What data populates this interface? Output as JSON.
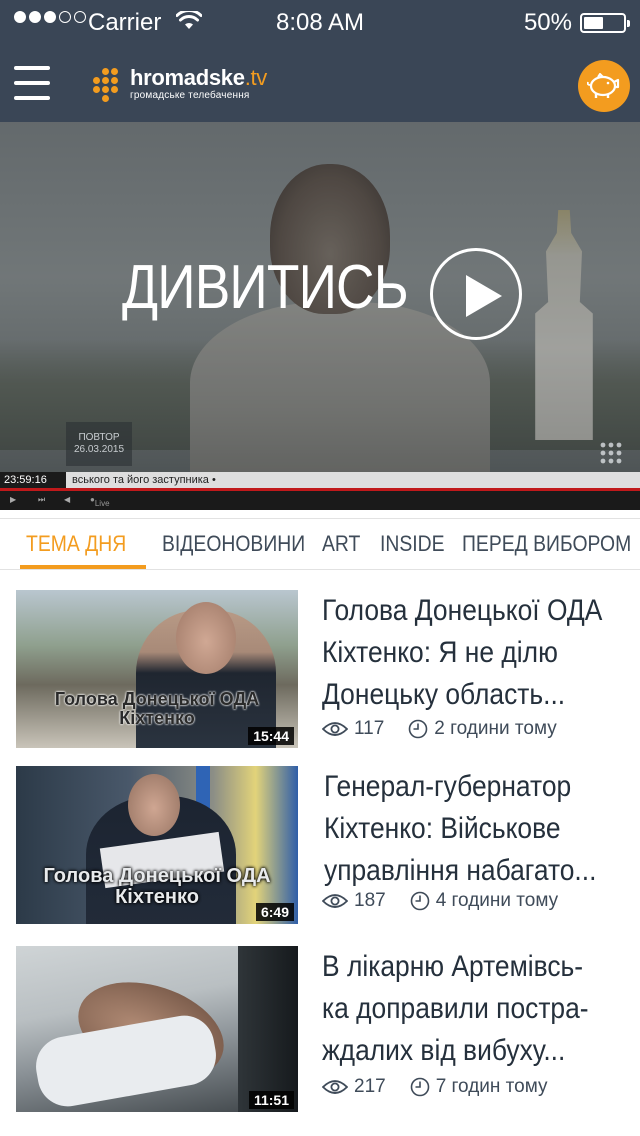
{
  "status_bar": {
    "carrier": "Carrier",
    "time": "8:08 AM",
    "battery": "50%"
  },
  "header": {
    "logo_name": "hromadske",
    "logo_tld": ".tv",
    "logo_subtitle": "громадське телебачення",
    "menu_icon": "hamburger-menu-icon",
    "donate_icon": "piggy-bank-icon"
  },
  "hero": {
    "watch_label": "ДИВИТИСЬ",
    "repeat_label": "ПОВТОР",
    "repeat_date": "26.03.2015",
    "ticker_time": "23:59:16",
    "ticker_text": "вського та його заступника •",
    "live_label": "Live"
  },
  "tabs": [
    {
      "label": "ТЕМА ДНЯ",
      "active": true
    },
    {
      "label": "ВІДЕОНОВИНИ",
      "active": false
    },
    {
      "label": "ART",
      "active": false
    },
    {
      "label": "INSIDE",
      "active": false
    },
    {
      "label": "ПЕРЕД ВИБОРОМ",
      "active": false
    }
  ],
  "news": [
    {
      "title_lines": [
        "Голова Донецької ОДА",
        "Кіхтенко: Я не ділю",
        "Донецьку область..."
      ],
      "caption_line1": "Голова Донецької ОДА",
      "caption_line2": "Кіхтенко",
      "duration": "15:44",
      "views": "117",
      "time_ago": "2 години тому"
    },
    {
      "title_lines": [
        "Генерал-губернатор",
        "Кіхтенко: Військове",
        "управління набагато..."
      ],
      "caption_line1": "Голова Донецької ОДА",
      "caption_line2": "Кіхтенко",
      "duration": "6:49",
      "views": "187",
      "time_ago": "4 години тому"
    },
    {
      "title_lines": [
        "В лікарню Артемівсь-",
        "ка доправили постра-",
        "ждалих від вибуху..."
      ],
      "caption_line1": "",
      "caption_line2": "",
      "duration": "11:51",
      "views": "217",
      "time_ago": "7 годин тому"
    }
  ],
  "colors": {
    "header_bg": "#3a4656",
    "accent": "#f39c1f",
    "text_dark": "#25303c",
    "text_muted": "#3f4b59"
  }
}
